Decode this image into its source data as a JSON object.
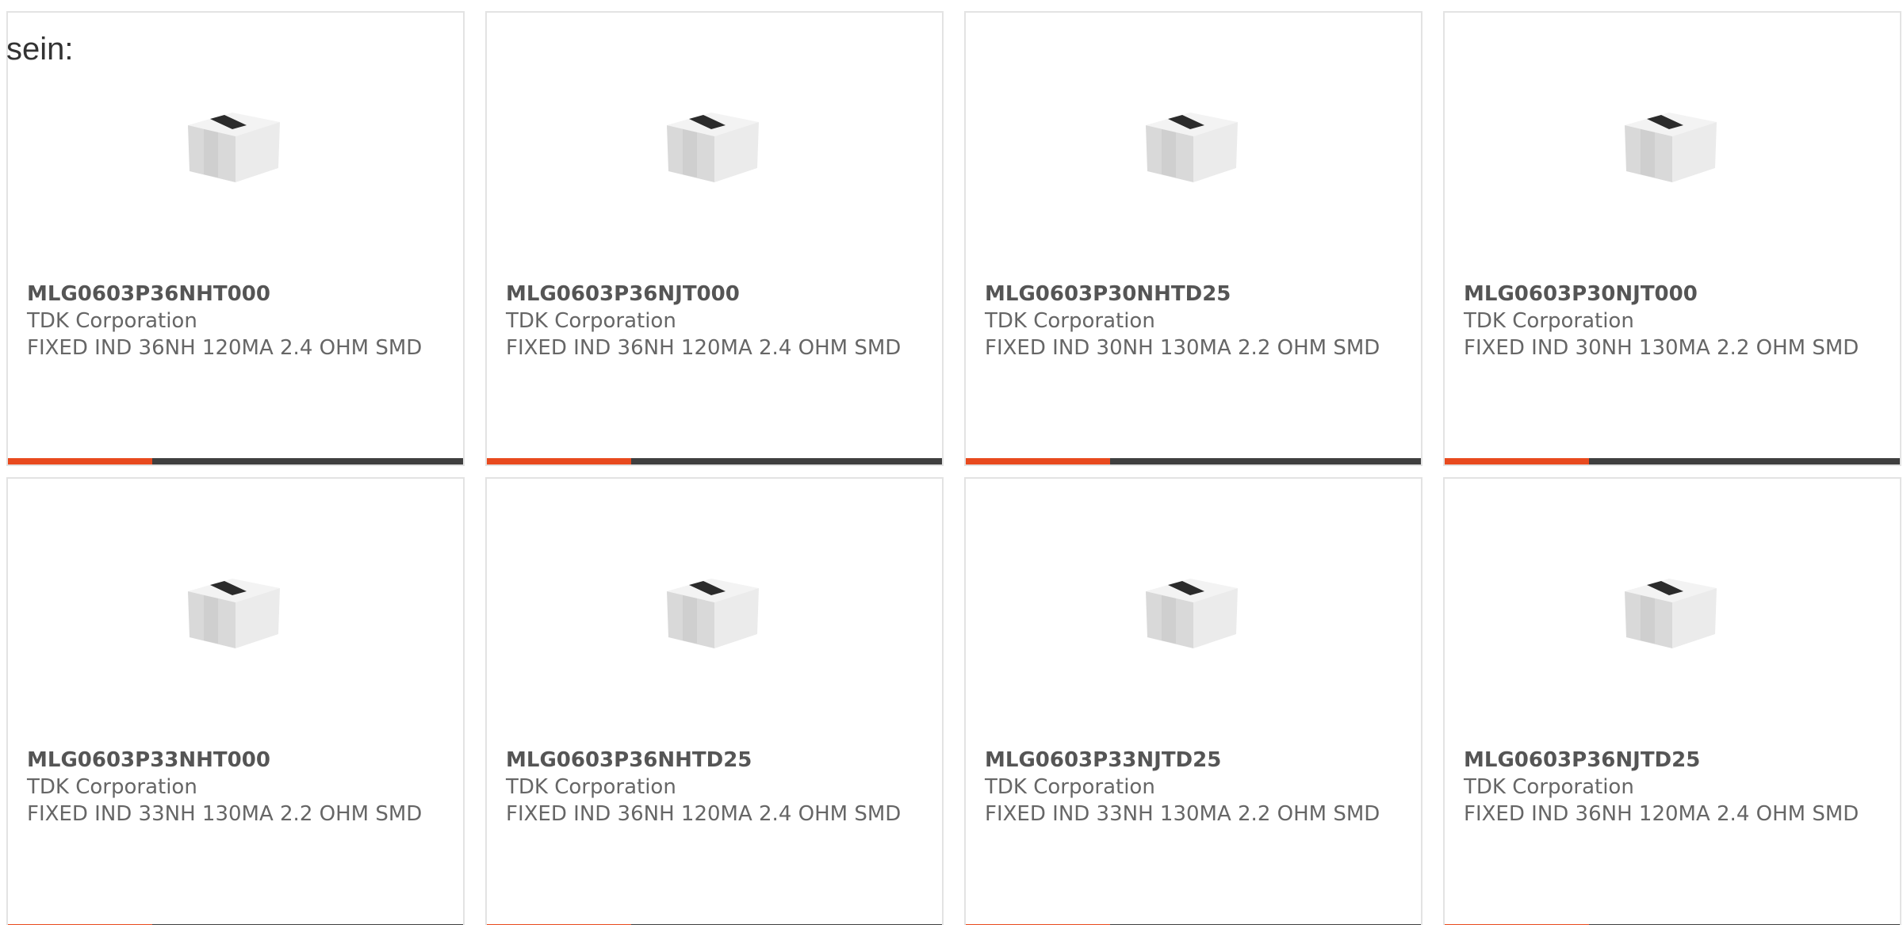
{
  "lead_text": "sein:",
  "colors": {
    "accent": "#e84a1e",
    "bar": "#3f3f3f",
    "border": "#e3e3e3",
    "text": "#666666"
  },
  "products": [
    {
      "part_number": "MLG0603P36NHT000",
      "manufacturer": "TDK Corporation",
      "description": "FIXED IND 36NH 120MA 2.4 OHM SMD",
      "image_icon": "smd-inductor-chip"
    },
    {
      "part_number": "MLG0603P36NJT000",
      "manufacturer": "TDK Corporation",
      "description": "FIXED IND 36NH 120MA 2.4 OHM SMD",
      "image_icon": "smd-inductor-chip"
    },
    {
      "part_number": "MLG0603P30NHTD25",
      "manufacturer": "TDK Corporation",
      "description": "FIXED IND 30NH 130MA 2.2 OHM SMD",
      "image_icon": "smd-inductor-chip"
    },
    {
      "part_number": "MLG0603P30NJT000",
      "manufacturer": "TDK Corporation",
      "description": "FIXED IND 30NH 130MA 2.2 OHM SMD",
      "image_icon": "smd-inductor-chip"
    },
    {
      "part_number": "MLG0603P33NHT000",
      "manufacturer": "TDK Corporation",
      "description": "FIXED IND 33NH 130MA 2.2 OHM SMD",
      "image_icon": "smd-inductor-chip"
    },
    {
      "part_number": "MLG0603P36NHTD25",
      "manufacturer": "TDK Corporation",
      "description": "FIXED IND 36NH 120MA 2.4 OHM SMD",
      "image_icon": "smd-inductor-chip"
    },
    {
      "part_number": "MLG0603P33NJTD25",
      "manufacturer": "TDK Corporation",
      "description": "FIXED IND 33NH 130MA 2.2 OHM SMD",
      "image_icon": "smd-inductor-chip"
    },
    {
      "part_number": "MLG0603P36NJTD25",
      "manufacturer": "TDK Corporation",
      "description": "FIXED IND 36NH 120MA 2.4 OHM SMD",
      "image_icon": "smd-inductor-chip"
    }
  ]
}
